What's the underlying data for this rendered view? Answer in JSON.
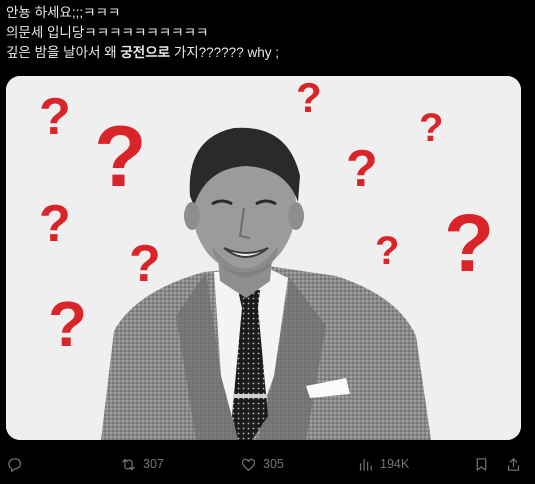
{
  "post": {
    "line1": "안뇽 하세요;;;ㅋㅋㅋ",
    "line2": "의문세 입니당ㅋㅋㅋㅋㅋㅋㅋㅋㅋㅋ",
    "line3_pre": "깊은 밤을 날아서 왜 ",
    "line3_bold": "궁전으로",
    "line3_post": " 가지?????? why ;"
  },
  "media": {
    "question_mark": "?",
    "accent_color": "#d9252a",
    "background_color": "#efefef"
  },
  "actions": {
    "reply_icon": "reply-icon",
    "retweet_icon": "retweet-icon",
    "retweet_count": "307",
    "like_icon": "heart-icon",
    "like_count": "305",
    "views_icon": "views-chart-icon",
    "views_count": "194K",
    "bookmark_icon": "bookmark-icon",
    "share_icon": "share-icon"
  }
}
